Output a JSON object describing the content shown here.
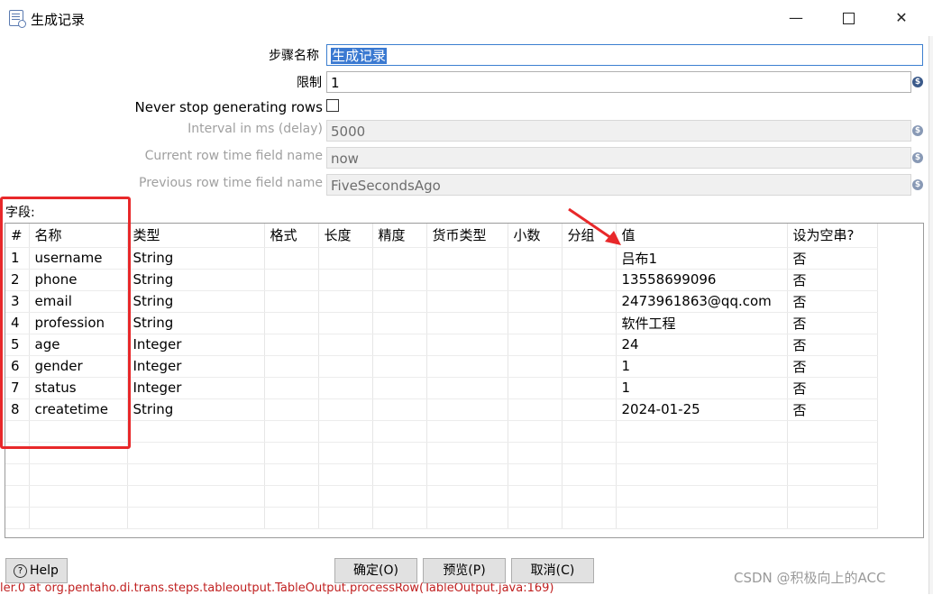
{
  "window": {
    "title": "生成记录",
    "minimize": "—",
    "close": "✕"
  },
  "form": {
    "step_name_label": "步骤名称",
    "step_name_value": "生成记录",
    "limit_label": "限制",
    "limit_value": "1",
    "never_stop_label": "Never stop generating rows",
    "never_stop_checked": false,
    "interval_label": "Interval in ms (delay)",
    "interval_value": "5000",
    "current_row_label": "Current row time field name",
    "current_row_value": "now",
    "previous_row_label": "Previous row time field name",
    "previous_row_value": "FiveSecondsAgo",
    "var_icon": "$"
  },
  "fields": {
    "label": "字段:",
    "columns": [
      "#",
      "名称",
      "类型",
      "格式",
      "长度",
      "精度",
      "货币类型",
      "小数",
      "分组",
      "值",
      "设为空串?"
    ],
    "rows": [
      {
        "num": "1",
        "name": "username",
        "type": "String",
        "value": "吕布1",
        "empty": "否"
      },
      {
        "num": "2",
        "name": "phone",
        "type": "String",
        "value": "13558699096",
        "empty": "否"
      },
      {
        "num": "3",
        "name": "email",
        "type": "String",
        "value": "2473961863@qq.com",
        "empty": "否"
      },
      {
        "num": "4",
        "name": "profession",
        "type": "String",
        "value": "软件工程",
        "empty": "否"
      },
      {
        "num": "5",
        "name": "age",
        "type": "Integer",
        "value": "24",
        "empty": "否"
      },
      {
        "num": "6",
        "name": "gender",
        "type": "Integer",
        "value": "1",
        "empty": "否"
      },
      {
        "num": "7",
        "name": "status",
        "type": "Integer",
        "value": "1",
        "empty": "否"
      },
      {
        "num": "8",
        "name": "createtime",
        "type": "String",
        "value": "2024-01-25",
        "empty": "否"
      }
    ]
  },
  "buttons": {
    "help": "Help",
    "ok": "确定(O)",
    "preview": "预览(P)",
    "cancel": "取消(C)"
  },
  "background_status": "ler.0   at org.pentaho.di.trans.steps.tableoutput.TableOutput.processRow(TableOutput.java:169)",
  "watermark": "CSDN @积极向上的ACC",
  "colors": {
    "annotation": "#e8282a",
    "selection": "#3a79d1"
  }
}
